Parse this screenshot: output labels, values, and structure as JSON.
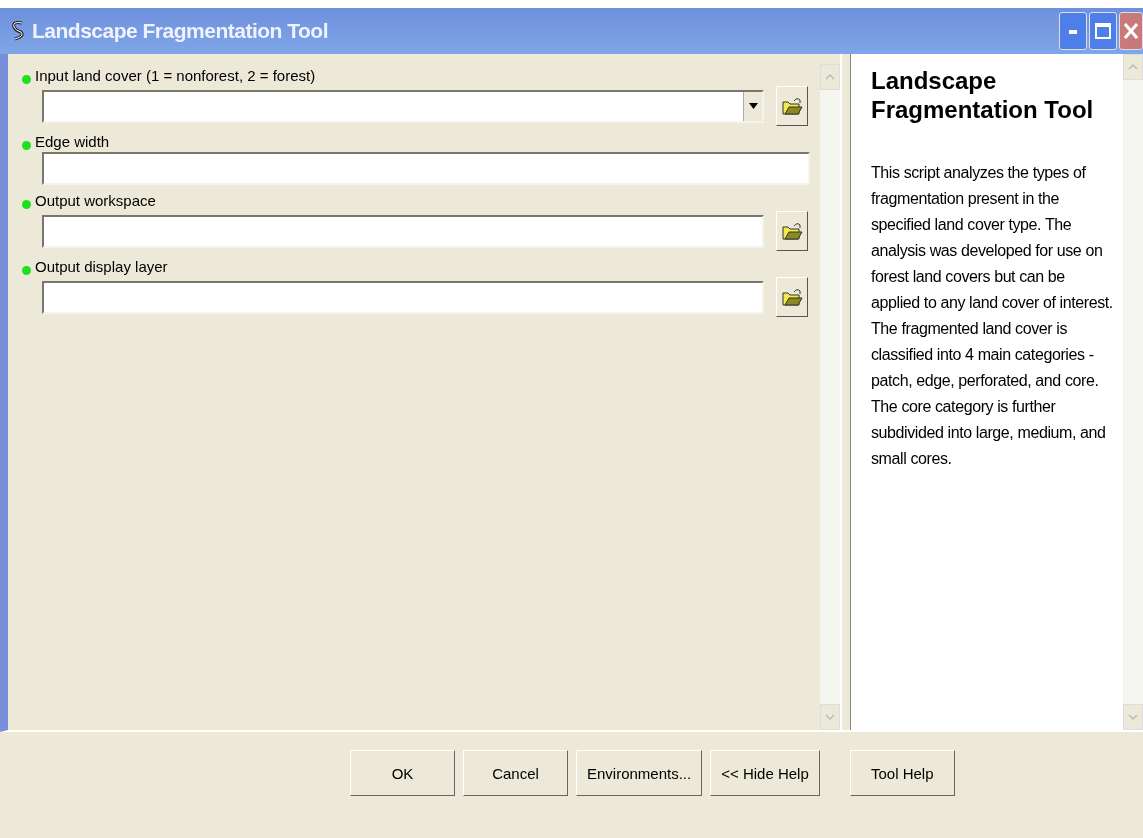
{
  "window": {
    "title": "Landscape Fragmentation Tool"
  },
  "parameters": [
    {
      "label": "Input land cover (1 = nonforest, 2 = forest)",
      "kind": "combo"
    },
    {
      "label": "Edge width",
      "kind": "text"
    },
    {
      "label": "Output workspace",
      "kind": "browse"
    },
    {
      "label": "Output display layer",
      "kind": "browse"
    }
  ],
  "help": {
    "title": "Landscape Fragmentation Tool",
    "body": "This script analyzes the types of fragmentation present in the specified land cover type. The analysis was developed for use on forest land covers but can be applied to any land cover of interest. The fragmented land cover is classified into 4 main categories - patch, edge, perforated, and core. The core category is further subdivided into large, medium, and small cores."
  },
  "buttons": [
    "OK",
    "Cancel",
    "Environments...",
    "<< Hide Help",
    "Tool Help"
  ]
}
